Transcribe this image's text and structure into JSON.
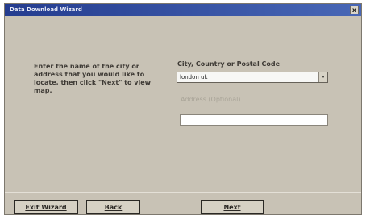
{
  "window": {
    "title": "Data Download Wizard",
    "close_label": "x"
  },
  "instructions": "Enter the name of the city or address that you would like to locate, then click \"Next\" to view map.",
  "city": {
    "label": "City, Country or Postal Code",
    "value": "london uk",
    "dropdown_glyph": "▾"
  },
  "address": {
    "label": "Address (Optional)",
    "value": ""
  },
  "buttons": {
    "exit": "Exit Wizard",
    "back": "Back",
    "next": "Next"
  },
  "colors": {
    "titlebar": "#243c8f",
    "dialog_bg": "#c8c2b5"
  }
}
